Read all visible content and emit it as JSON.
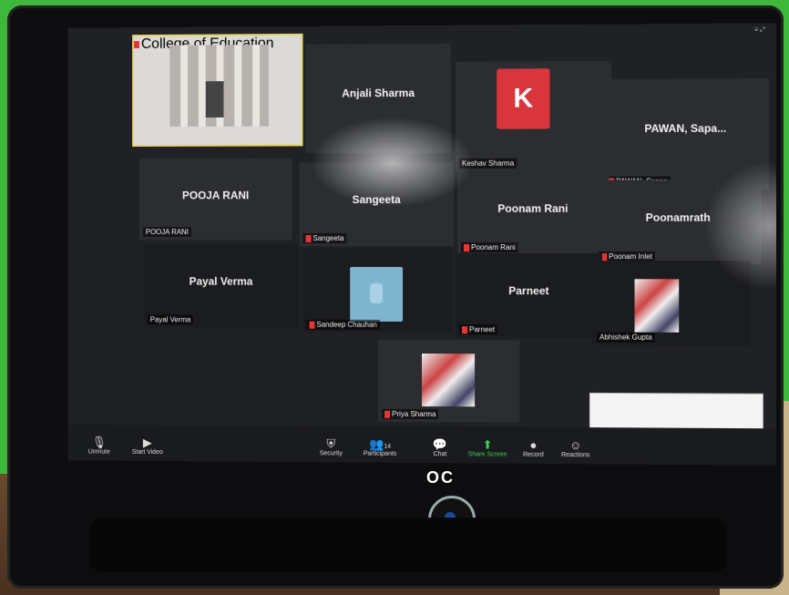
{
  "monitor": {
    "brand": "OC"
  },
  "window": {
    "corner_text": "≡ ⤢"
  },
  "tiles": {
    "top_video": {
      "name": "College of Education"
    },
    "anjali": {
      "center": "Anjali Sharma"
    },
    "k_tile": {
      "avatar_letter": "K",
      "name": "Keshav Sharma"
    },
    "pawan": {
      "center": "PAWAN, Sapa...",
      "name": "PAWAN, Sapna"
    },
    "pooja": {
      "center": "POOJA RANI",
      "name": "POOJA RANI"
    },
    "sangeeta": {
      "center": "Sangeeta",
      "name": "Sangeeta"
    },
    "poonam": {
      "center": "Poonam Rani",
      "name": "Poonam Rani"
    },
    "poonamrat": {
      "center": "Poonamrath",
      "name": "Poonam Inlet"
    },
    "payal": {
      "center": "Payal Verma",
      "name": "Payal Verma"
    },
    "sandeep": {
      "name": "Sandeep Chauhan"
    },
    "parneet": {
      "center": "Parneet",
      "name": "Parneet"
    },
    "abhishek": {
      "name": "Abhishek Gupta"
    },
    "bottom": {
      "name": "Priya Sharma"
    }
  },
  "toolbar": {
    "unmute": "Unmute",
    "start_video": "Start Video",
    "security": "Security",
    "participants": "Participants",
    "participants_count": "14",
    "chat": "Chat",
    "share_screen": "Share Screen",
    "record": "Record",
    "reactions": "Reactions"
  },
  "colors": {
    "avatar_k": "#d8353c",
    "share_green": "#3fd14a",
    "background_green": "#3db83a"
  }
}
